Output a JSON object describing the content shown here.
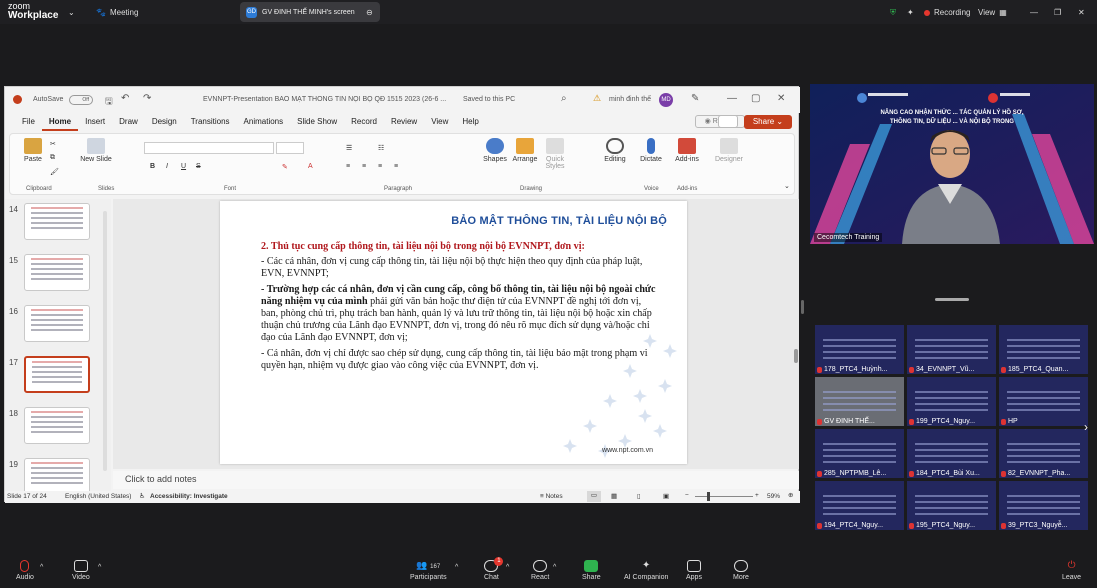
{
  "zoom": {
    "brand_top": "zoom",
    "brand_bottom": "Workplace",
    "meeting_label": "Meeting",
    "share_tab_badge": "GD",
    "share_tab_label": "GV ĐINH THẾ MINH's screen",
    "recording_label": "Recording",
    "view_label": "View",
    "bottom": {
      "audio": "Audio",
      "video": "Video",
      "participants": "Participants",
      "participants_count": "167",
      "chat": "Chat",
      "chat_badge": "1",
      "react": "React",
      "share": "Share",
      "ai_companion": "AI Companion",
      "apps": "Apps",
      "more": "More",
      "leave": "Leave"
    },
    "colors": {
      "share_green": "#2fb34f",
      "leave_red": "#e5372e",
      "rec_red": "#e5372e"
    }
  },
  "ppt": {
    "autosave": "AutoSave",
    "autosave_state": "Off",
    "filename": "EVNNPT-Presentation BẢO MẬT THÔNG TIN NỘI BỘ QĐ 1515 2023 (26-6 ...",
    "saved_status": "Saved to this PC",
    "user_name": "minh đinh thế",
    "user_initials": "MD",
    "menu_tabs": [
      "File",
      "Home",
      "Insert",
      "Draw",
      "Design",
      "Transitions",
      "Animations",
      "Slide Show",
      "Record",
      "Review",
      "View",
      "Help"
    ],
    "record_button": "Record",
    "share_button": "Share",
    "ribbon": {
      "paste": "Paste",
      "new_slide": "New Slide",
      "shapes": "Shapes",
      "arrange": "Arrange",
      "quick_styles": "Quick Styles",
      "editing": "Editing",
      "dictate": "Dictate",
      "addins": "Add-ins",
      "designer": "Designer",
      "groups": [
        "Clipboard",
        "Slides",
        "Font",
        "Paragraph",
        "Drawing",
        "Voice",
        "Add-ins"
      ]
    },
    "slide_numbers": [
      "14",
      "15",
      "16",
      "17",
      "18",
      "19"
    ],
    "selected_slide": "17",
    "notes_placeholder": "Click to add notes",
    "status": {
      "slide_of": "Slide 17 of 24",
      "language": "English (United States)",
      "accessibility": "Accessibility: Investigate",
      "notes": "Notes",
      "zoom": "59%"
    },
    "colors": {
      "accent": "#c43e1c",
      "title_blue": "#1f4e9a",
      "heading_red": "#b0171c"
    }
  },
  "slide": {
    "title": "BẢO MẬT THÔNG TIN, TÀI LIỆU NỘI BỘ",
    "heading": "2. Thủ tục cung cấp thông tin, tài liệu nội bộ trong nội bộ EVNNPT, đơn vị:",
    "para1": "- Các cá nhân, đơn vị cung cấp thông tin, tài liệu nội bộ thực hiện theo quy định của pháp luật, EVN, EVNNPT;",
    "para2_bold": "- Trường hợp các cá nhân, đơn vị cần cung cấp, công bố thông tin, tài liệu nội bộ ngoài chức năng nhiệm vụ của mình",
    "para2_rest": " phải gửi văn bản hoặc thư điện tử của EVNNPT đề nghị tới đơn vị, ban, phòng chủ trì, phụ trách ban hành, quản lý và lưu trữ thông tin, tài liệu nội bộ hoặc xin chấp thuận chủ trương của Lãnh đạo EVNNPT, đơn vị, trong đó nêu rõ mục đích sử dụng và/hoặc chỉ đạo của Lãnh đạo EVNNPT, đơn vị;",
    "para3": "- Cá nhân, đơn vị chỉ được sao chép sử dụng, cung cấp thông tin, tài liệu bảo mật trong phạm vi quyền hạn, nhiệm vụ được giao vào công việc của EVNNPT, đơn vị.",
    "url": "www.npt.com.vn"
  },
  "speaker": {
    "name": "Cecomtech Training",
    "banner_line1": "NÂNG CAO NHẬN THỨC ... TÁC QUẢN LÝ HỒ SƠ,",
    "banner_line2": "THÔNG TIN, DỮ LIỆU ... VÀ NỘI BỘ TRONG"
  },
  "participants": [
    "178_PTC4_Huỳnh...",
    "34_EVNNPT_Vũ...",
    "185_PTC4_Quan...",
    "GV ĐINH THẾ...",
    "199_PTC4_Nguy...",
    "HP",
    "285_NPTPMB_Lê...",
    "184_PTC4_Bùi Xu...",
    "82_EVNNPT_Pha...",
    "194_PTC4_Nguy...",
    "195_PTC4_Nguy...",
    "39_PTC3_Nguyễ..."
  ]
}
